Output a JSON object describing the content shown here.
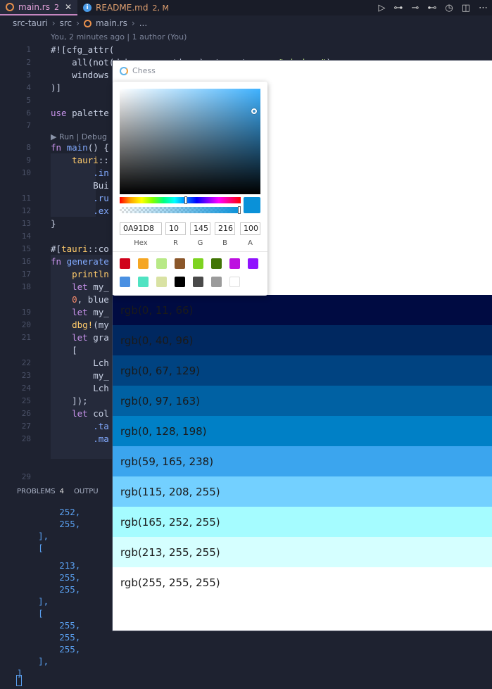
{
  "tabs": [
    {
      "label": "main.rs",
      "badge": "2",
      "active": true
    },
    {
      "label": "README.md",
      "badge": "2, M",
      "active": false
    }
  ],
  "breadcrumb": [
    "src-tauri",
    "src",
    "main.rs",
    "..."
  ],
  "blame": "You, 2 minutes ago | 1 author (You)",
  "code_lines": [
    {
      "n": "1",
      "text": "#![cfg_attr("
    },
    {
      "n": "2",
      "text": "    all(not(debug_assertions), target_os = \"windows\")"
    },
    {
      "n": "3",
      "text": "    windows"
    },
    {
      "n": "4",
      "text": ")]"
    },
    {
      "n": "5",
      "text": ""
    },
    {
      "n": "6",
      "text": "use palette"
    },
    {
      "n": "7",
      "text": ""
    },
    {
      "n": "8",
      "text": "fn main() {"
    },
    {
      "n": "9",
      "text": "    tauri::"
    },
    {
      "n": "10",
      "text": "        .in"
    },
    {
      "n": "",
      "text": "        Bui"
    },
    {
      "n": "11",
      "text": "        .ru"
    },
    {
      "n": "12",
      "text": "        .ex"
    },
    {
      "n": "13",
      "text": "}"
    },
    {
      "n": "14",
      "text": ""
    },
    {
      "n": "15",
      "text": "#[tauri::co"
    },
    {
      "n": "16",
      "text": "fn generate"
    },
    {
      "n": "17",
      "text": "    println"
    },
    {
      "n": "18",
      "text": "    let my_"
    },
    {
      "n": "",
      "text": "    0, blue"
    },
    {
      "n": "19",
      "text": "    let my_"
    },
    {
      "n": "20",
      "text": "    dbg!(my"
    },
    {
      "n": "21",
      "text": "    let gra"
    },
    {
      "n": "",
      "text": "    ["
    },
    {
      "n": "22",
      "text": "        Lch"
    },
    {
      "n": "23",
      "text": "        my_"
    },
    {
      "n": "24",
      "text": "        Lch"
    },
    {
      "n": "25",
      "text": "    ]);"
    },
    {
      "n": "26",
      "text": "    let col"
    },
    {
      "n": "27",
      "text": "        .ta"
    },
    {
      "n": "28",
      "text": "        .ma"
    },
    {
      "n": "29",
      "text": ""
    }
  ],
  "codelens": "▶ Run | Debug",
  "panel": {
    "problems_label": "PROBLEMS",
    "problems_count": "4",
    "output_label": "OUTPU"
  },
  "terminal_lines": [
    "        252,",
    "        255,",
    "    ],",
    "    [",
    "        213,",
    "        255,",
    "        255,",
    "    ],",
    "    [",
    "        255,",
    "        255,",
    "        255,",
    "    ],",
    "]"
  ],
  "chess_app": {
    "title": "Chess",
    "picker": {
      "hex": "0A91D8",
      "r": "10",
      "g": "145",
      "b": "216",
      "a": "100",
      "labels": {
        "hex": "Hex",
        "r": "R",
        "g": "G",
        "b": "B",
        "a": "A"
      },
      "hue_position": 0.55,
      "alpha_position": 1.0,
      "current_color": "#0a91d8",
      "presets": [
        "#d0021b",
        "#f5a623",
        "#b8e986",
        "#8b572a",
        "#7ed321",
        "#417505",
        "#bd10e0",
        "#9013fe",
        "#4a90e2",
        "#50e3c2",
        "#d9e2a3",
        "#000000",
        "#4a4a4a",
        "#9b9b9b",
        "#ffffff"
      ]
    },
    "swatches": [
      {
        "label": "rgb(0, 11, 66)",
        "color": "#000b42"
      },
      {
        "label": "rgb(0, 40, 96)",
        "color": "#002860"
      },
      {
        "label": "rgb(0, 67, 129)",
        "color": "#004381"
      },
      {
        "label": "rgb(0, 97, 163)",
        "color": "#0061a3"
      },
      {
        "label": "rgb(0, 128, 198)",
        "color": "#0080c6"
      },
      {
        "label": "rgb(59, 165, 238)",
        "color": "#3ba5ee"
      },
      {
        "label": "rgb(115, 208, 255)",
        "color": "#73d0ff"
      },
      {
        "label": "rgb(165, 252, 255)",
        "color": "#a5fcff"
      },
      {
        "label": "rgb(213, 255, 255)",
        "color": "#d5ffff"
      },
      {
        "label": "rgb(255, 255, 255)",
        "color": "#ffffff"
      }
    ]
  }
}
